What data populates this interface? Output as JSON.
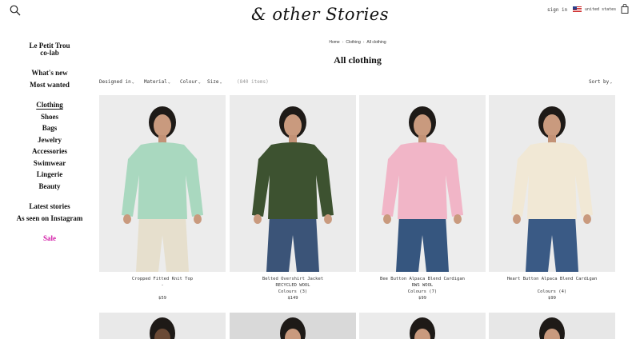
{
  "header": {
    "logo": "& other Stories",
    "signin": "sign in",
    "country": "united states",
    "icons": [
      "search-icon",
      "us-flag-icon",
      "shopping-bag-icon"
    ]
  },
  "sidebar": {
    "featured": [
      "Le Petit Trou",
      "co-lab"
    ],
    "new": [
      "What's new",
      "Most wanted"
    ],
    "categories": [
      "Clothing",
      "Shoes",
      "Bags",
      "Jewelry",
      "Accessories",
      "Swimwear",
      "Lingerie",
      "Beauty"
    ],
    "active_category": "Clothing",
    "editorial": [
      "Latest stories",
      "As seen on Instagram"
    ],
    "sale": "Sale"
  },
  "breadcrumb": [
    "Home",
    "Clothing",
    "All clothing"
  ],
  "page_title": "All clothing",
  "filters": {
    "designed_in": "Designed in",
    "material": "Material",
    "colour": "Colour",
    "size": "Size",
    "count": "(840 items)",
    "sort": "Sort by"
  },
  "products": [
    {
      "name": "Cropped Fitted Knit Top",
      "material": "-",
      "colours": "",
      "price": "$59",
      "garment": "#a9d8bf",
      "bottom": "#e6dfcd",
      "bg": "#ececec"
    },
    {
      "name": "Belted Overshirt Jacket",
      "material": "RECYCLED WOOL",
      "colours": "Colours (3)",
      "price": "$149",
      "garment": "#3d5230",
      "bottom": "#3b5478",
      "bg": "#ebebeb"
    },
    {
      "name": "Bee Button Alpaca Blend Cardigan",
      "material": "RWS WOOL",
      "colours": "Colours (7)",
      "price": "$99",
      "garment": "#f1b5c7",
      "bottom": "#36567f",
      "bg": "#ededed"
    },
    {
      "name": "Heart Button Alpaca Blend Cardigan",
      "material": "",
      "colours": "Colours (4)",
      "price": "$99",
      "garment": "#f1e8d5",
      "bottom": "#3a5a85",
      "bg": "#ebebeb"
    }
  ],
  "colors": {
    "accent_sale": "#d31ba7",
    "photo_bg": "#e8e8e8"
  }
}
